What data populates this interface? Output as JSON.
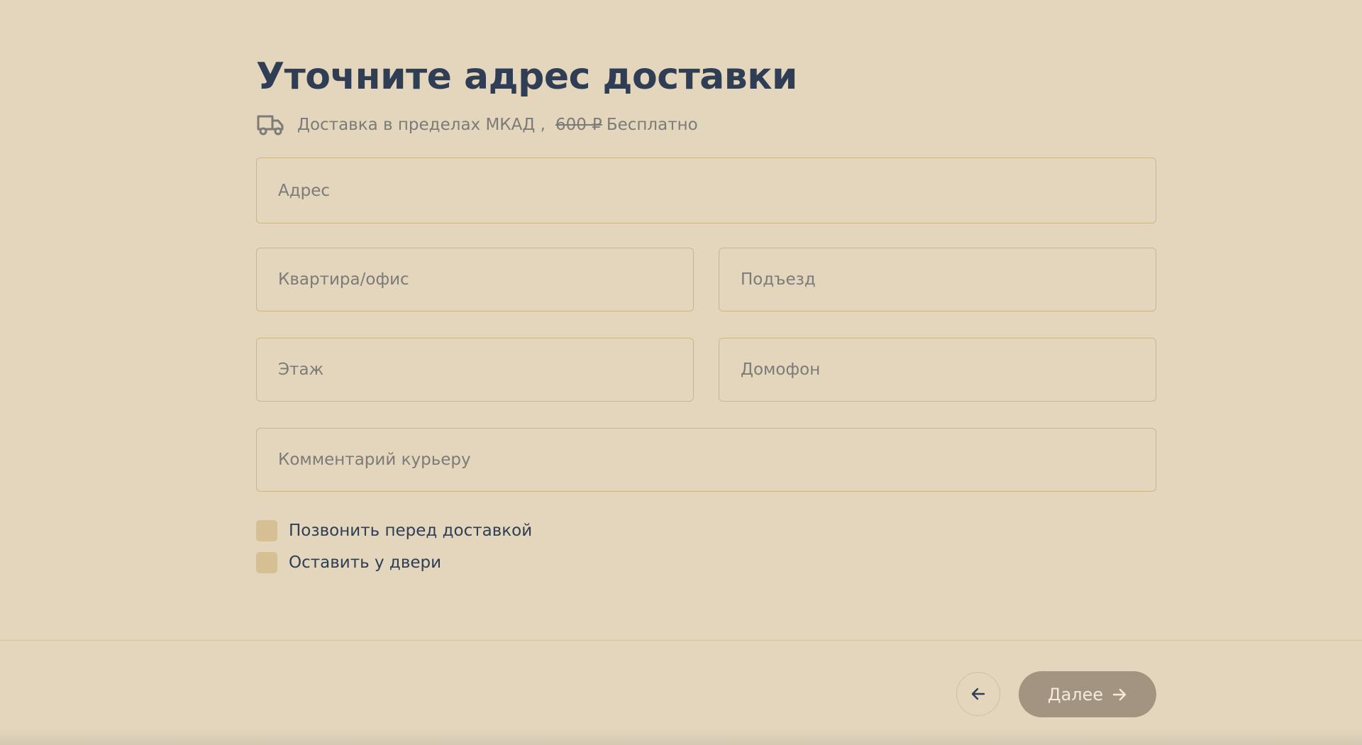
{
  "page": {
    "title": "Уточните адрес доставки",
    "delivery": {
      "zone_text": "Доставка в пределах МКАД ,",
      "old_price": "600 ₽",
      "price": "Бесплатно",
      "icon": "truck-icon"
    }
  },
  "form": {
    "address_placeholder": "Адрес",
    "apartment_placeholder": "Квартира/офис",
    "entrance_placeholder": "Подъезд",
    "floor_placeholder": "Этаж",
    "intercom_placeholder": "Домофон",
    "comment_placeholder": "Комментарий курьеру"
  },
  "options": {
    "call_before": "Позвонить перед доставкой",
    "leave_at_door": "Оставить у двери"
  },
  "footer": {
    "back_icon": "arrow-left-icon",
    "next_label": "Далее",
    "next_icon": "arrow-right-icon"
  },
  "colors": {
    "background": "#e4d6bc",
    "heading": "#2f3e55",
    "field_border": "#cdb584",
    "checkbox": "#d6bf93",
    "next_button": "#a39481"
  }
}
